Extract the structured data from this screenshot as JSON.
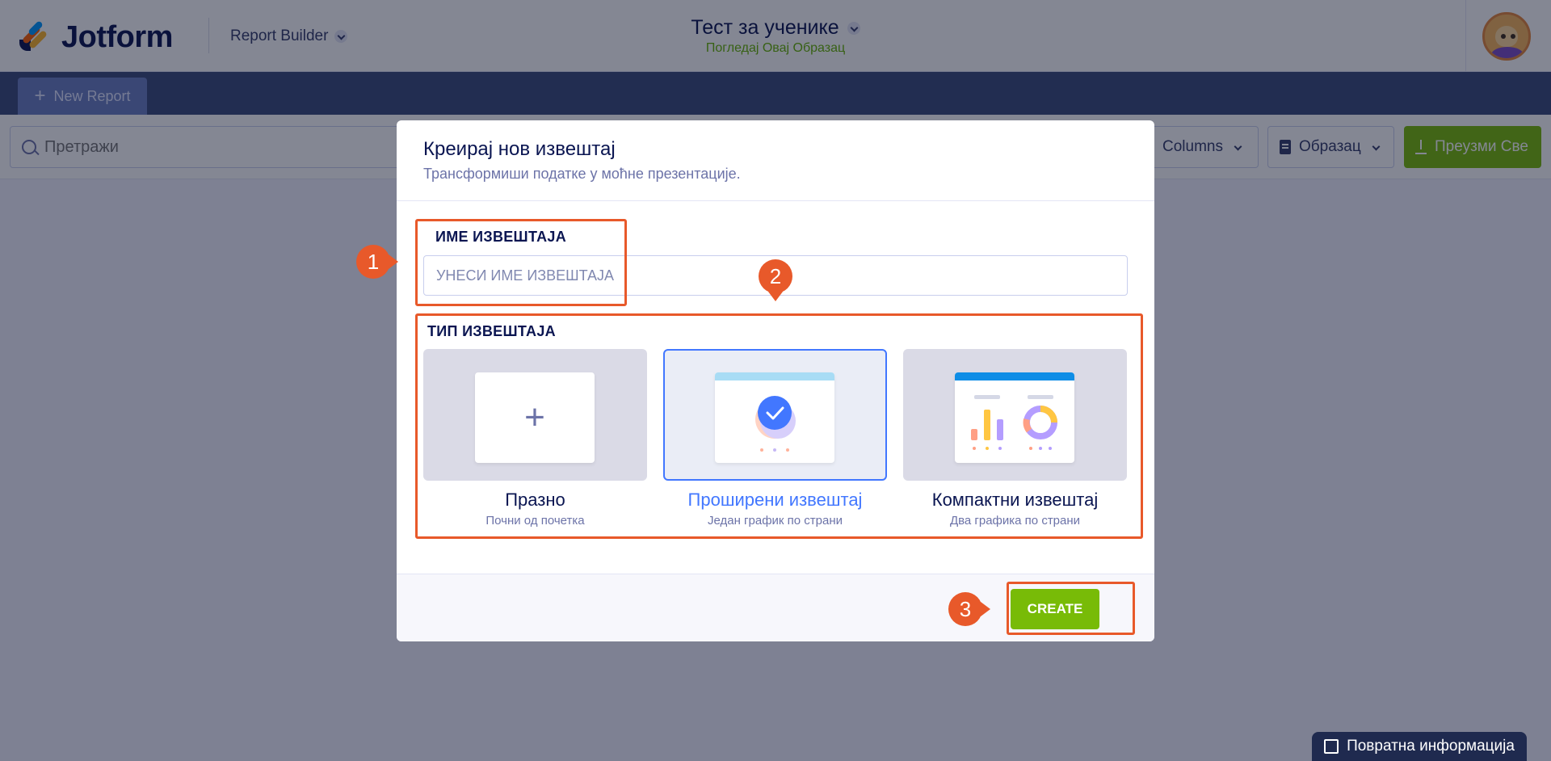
{
  "header": {
    "brand": "Jotform",
    "builder": "Report Builder",
    "form_title": "Тест за ученике",
    "form_link": "Погледај Овај Образац"
  },
  "tabs": {
    "new_report": "New Report"
  },
  "toolbar": {
    "search_placeholder": "Претражи",
    "columns": "Columns",
    "form": "Образац",
    "download_all": "Преузми Све"
  },
  "modal": {
    "title": "Креирај нов извештај",
    "subtitle": "Трансформиши податке у моћне презентације.",
    "name_label": "ИМЕ ИЗВЕШТАЈА",
    "name_placeholder": "УНЕСИ ИМЕ ИЗВЕШТАЈА",
    "type_label": "ТИП ИЗВЕШТАЈА",
    "types": [
      {
        "title": "Празно",
        "subtitle": "Почни од почетка",
        "selected": false
      },
      {
        "title": "Проширени извештај",
        "subtitle": "Један график по страни",
        "selected": true
      },
      {
        "title": "Компактни извештај",
        "subtitle": "Два графика по страни",
        "selected": false
      }
    ],
    "create": "CREATE"
  },
  "annotations": [
    "1",
    "2",
    "3"
  ],
  "feedback": "Повратна информација",
  "colors": {
    "accent_green": "#78bb07",
    "selected_blue": "#4277ff",
    "annotation_orange": "#e8592a",
    "navy": "#0a1551"
  }
}
